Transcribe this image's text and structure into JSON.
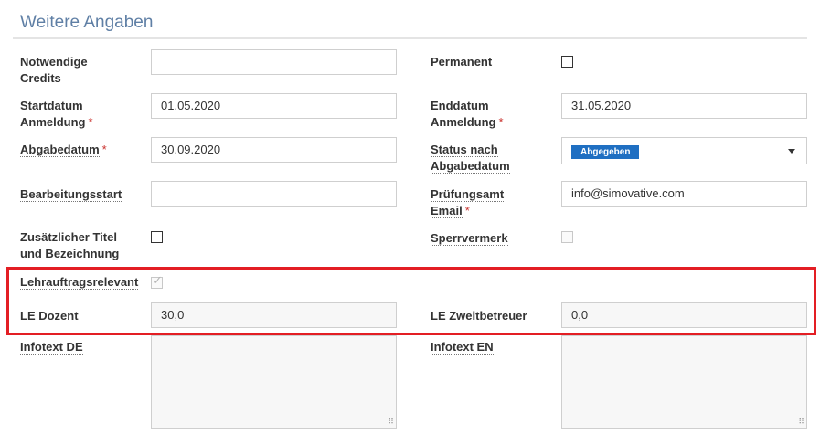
{
  "section": {
    "title": "Weitere Angaben"
  },
  "left": {
    "credits": {
      "label_line1": "Notwendige",
      "label_line2": "Credits",
      "value": ""
    },
    "start": {
      "label_line1": "Startdatum",
      "label_line2": "Anmeldung",
      "value": "01.05.2020"
    },
    "abgabe": {
      "label": "Abgabedatum",
      "value": "30.09.2020"
    },
    "bearbeitung": {
      "label": "Bearbeitungsstart",
      "value": ""
    },
    "zusatz": {
      "label_line1": "Zusätzlicher Titel",
      "label_line2": "und Bezeichnung",
      "checked": false
    },
    "lehrauftrag": {
      "label": "Lehrauftragsrelevant",
      "checked": true
    },
    "le_dozent": {
      "label": "LE Dozent",
      "value": "30,0"
    },
    "infotext_de": {
      "label": "Infotext DE",
      "value": ""
    }
  },
  "right": {
    "permanent": {
      "label": "Permanent",
      "checked": false
    },
    "end": {
      "label_line1": "Enddatum",
      "label_line2": "Anmeldung",
      "value": "31.05.2020"
    },
    "status": {
      "label_line1": "Status nach",
      "label_line2": "Abgabedatum",
      "selected": "Abgegeben"
    },
    "pruefungsamt": {
      "label_line1": "Prüfungsamt",
      "label_line2": "Email",
      "value": "info@simovative.com"
    },
    "sperrvermerk": {
      "label": "Sperrvermerk",
      "checked": false
    },
    "le_zweit": {
      "label": "LE Zweitbetreuer",
      "value": "0,0"
    },
    "infotext_en": {
      "label": "Infotext EN",
      "value": ""
    }
  },
  "required_marker": "*",
  "icons": {
    "checkmark": "check-icon",
    "dropdown": "chevron-down-icon",
    "resize": "resize-grip-icon"
  },
  "colors": {
    "title": "#5f7fa5",
    "badge": "#1f6fc2",
    "required": "#c9302c",
    "highlight": "#e31e24"
  }
}
